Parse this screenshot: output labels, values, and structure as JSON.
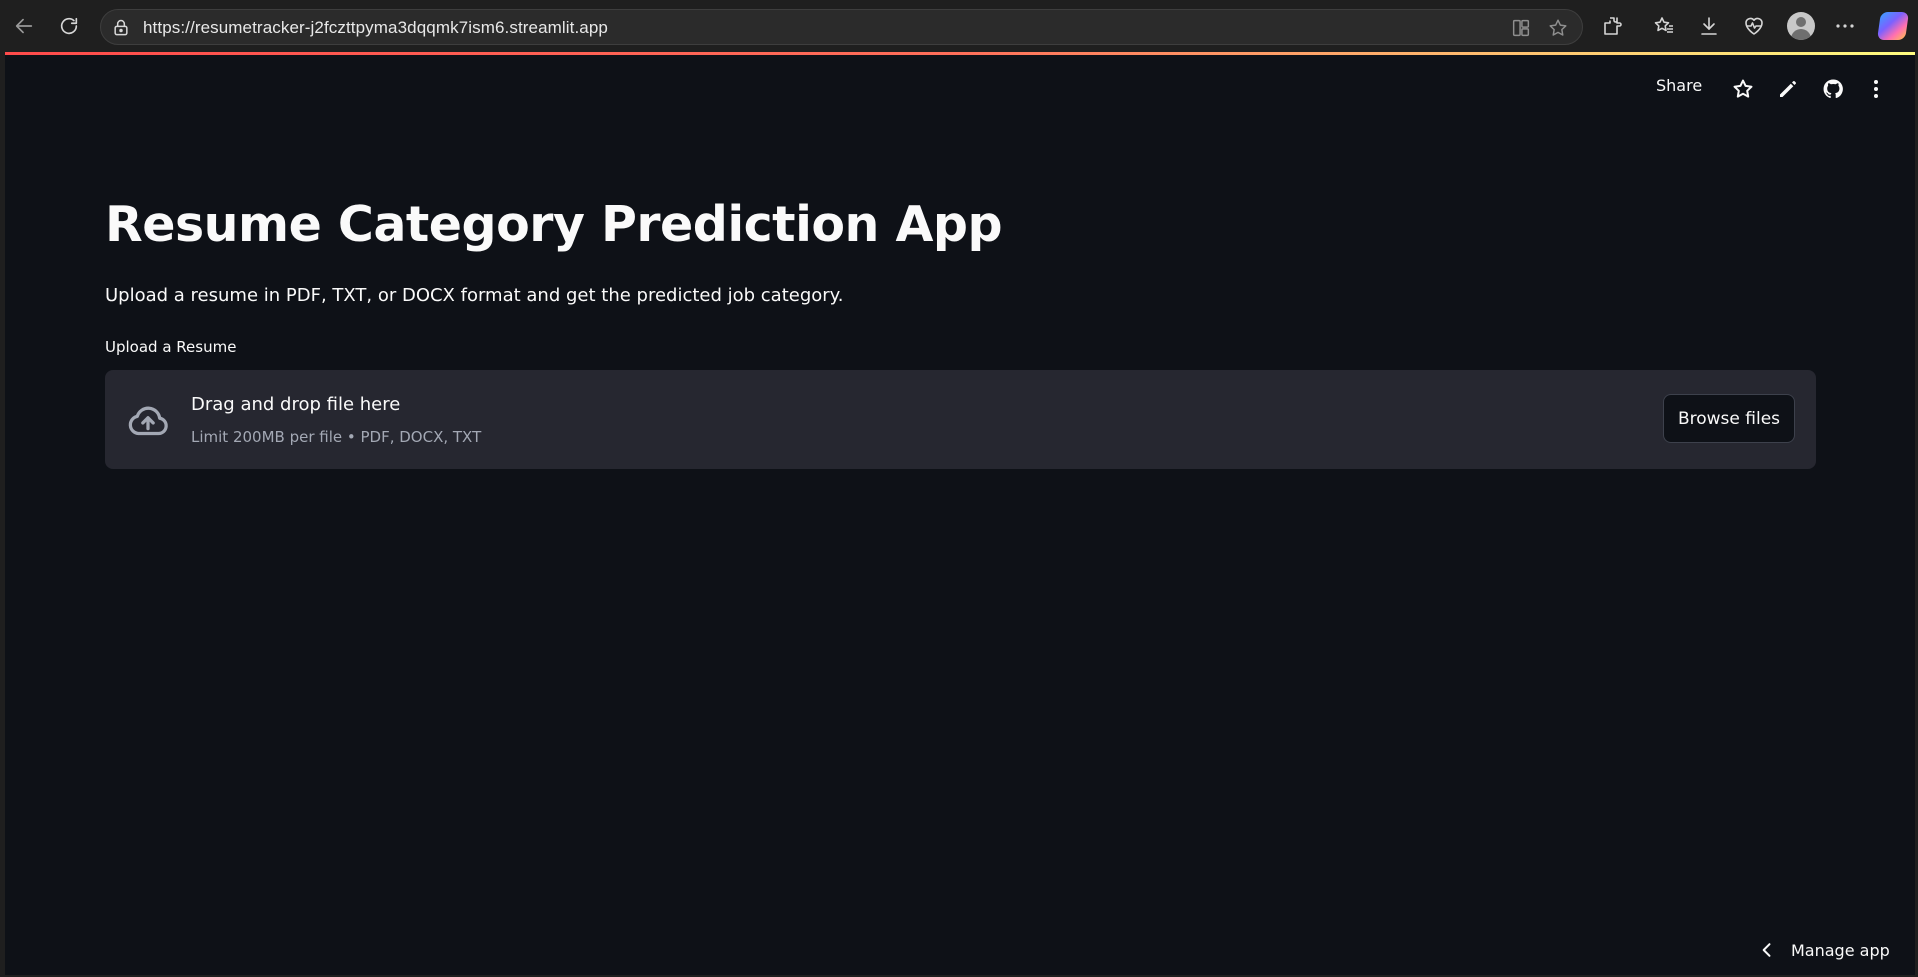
{
  "browser": {
    "url": "https://resumetracker-j2fczttpyma3dqqmk7ism6.streamlit.app",
    "icons": [
      "back-arrow-icon",
      "reload-icon",
      "lock-icon",
      "split-screen-icon",
      "favorite-star-icon",
      "extensions-icon",
      "favorites-icon",
      "download-icon",
      "health-icon",
      "profile-avatar",
      "more-icon",
      "copilot-icon"
    ]
  },
  "header": {
    "share_label": "Share",
    "icons": [
      "star-icon",
      "edit-pencil-icon",
      "github-icon",
      "more-vertical-icon"
    ]
  },
  "main": {
    "title": "Resume Category Prediction App",
    "description": "Upload a resume in PDF, TXT, or DOCX format and get the predicted job category.",
    "uploader": {
      "label": "Upload a Resume",
      "drop_text": "Drag and drop file here",
      "limit_text": "Limit 200MB per file • PDF, DOCX, TXT",
      "button_label": "Browse files"
    }
  },
  "footer": {
    "manage_app_label": "Manage app"
  },
  "colors": {
    "page_bg": "#0e1117",
    "dropzone_bg": "#262730",
    "text": "#fafafa",
    "muted": "#a3a8b4",
    "decoration_start": "#ff4b4b",
    "decoration_end": "#fffd80"
  }
}
